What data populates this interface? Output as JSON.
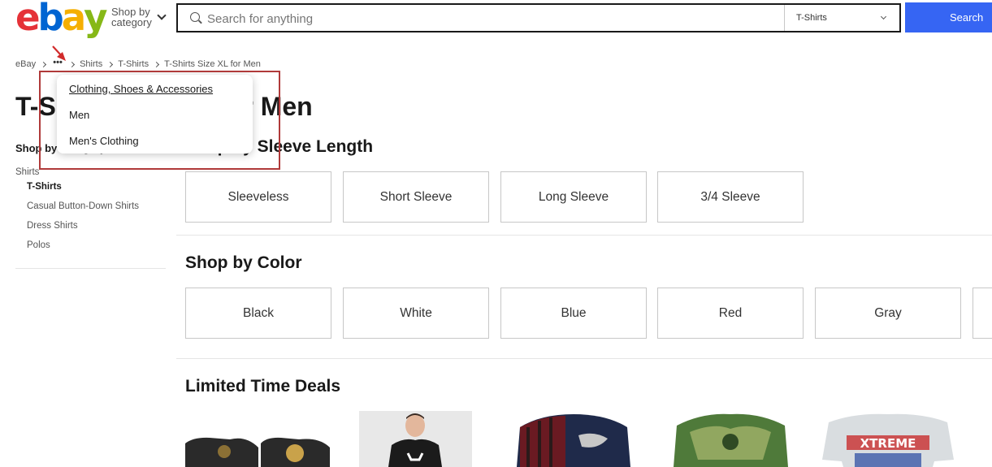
{
  "header": {
    "logo_letters": [
      "e",
      "b",
      "a",
      "y"
    ],
    "logo_colors": [
      "#e53238",
      "#0064d2",
      "#f5af02",
      "#86b817"
    ],
    "shop_by_category_line1": "Shop by",
    "shop_by_category_line2": "category",
    "search_placeholder": "Search for anything",
    "category_select_value": "T-Shirts",
    "search_button_label": "Search",
    "accent_color": "#3665f3"
  },
  "breadcrumb": {
    "items": [
      "eBay",
      "Shirts",
      "T-Shirts",
      "T-Shirts Size XL for Men"
    ],
    "more_label": "•••"
  },
  "breadcrumb_popup": {
    "items": [
      "Clothing, Shoes & Accessories",
      "Men",
      "Men's Clothing"
    ]
  },
  "page_title": "T-Shirts Size XL for Men",
  "sidebar": {
    "heading": "Shop by Category",
    "parent": "Shirts",
    "children": [
      "T-Shirts",
      "Casual Button-Down Shirts",
      "Dress Shirts",
      "Polos"
    ],
    "active": "T-Shirts"
  },
  "sleeve_section": {
    "title": "Shop by Sleeve Length",
    "tiles": [
      "Sleeveless",
      "Short Sleeve",
      "Long Sleeve",
      "3/4 Sleeve"
    ]
  },
  "color_section": {
    "title": "Shop by Color",
    "tiles": [
      "Black",
      "White",
      "Blue",
      "Red",
      "Gray"
    ]
  },
  "deals_section": {
    "title": "Limited Time Deals",
    "deal_thumb_5_text": "XTREME"
  },
  "annotation": {
    "highlight_color": "#b03a3a",
    "arrow_color": "#d12b2b"
  }
}
